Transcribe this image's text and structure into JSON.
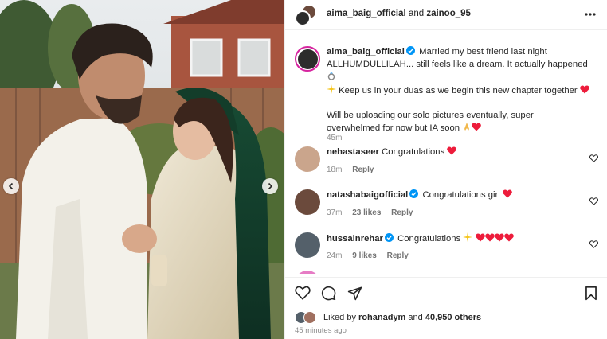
{
  "post": {
    "author": "aima_baig_official",
    "collaborator_joiner": "and",
    "collaborator": "zainoo_95"
  },
  "caption": {
    "username": "aima_baig_official",
    "text_1": "Married my best friend last night ALLHUMDULLILAH... still feels like a dream. It actually happened",
    "text_2": "Keep us in your duas as we begin this new chapter together",
    "text_3": "Will be uploading our solo pictures eventually, super overwhelmed for now but IA soon",
    "time": "45m"
  },
  "comments": [
    {
      "username": "nehastaseer",
      "text": "Congratulations",
      "time": "18m",
      "likes": "",
      "reply": "Reply",
      "verified": false,
      "avatar_color": "#caa58c"
    },
    {
      "username": "natashabaigofficial",
      "text": "Congratulations girl",
      "time": "37m",
      "likes": "23 likes",
      "reply": "Reply",
      "verified": true,
      "avatar_color": "#6b4a3c"
    },
    {
      "username": "hussainrehar",
      "text": "Congratulations",
      "time": "24m",
      "likes": "9 likes",
      "reply": "Reply",
      "verified": true,
      "avatar_color": "#54606a"
    }
  ],
  "likes": {
    "prefix": "Liked by",
    "user": "rohanadym",
    "joiner": "and",
    "others": "40,950 others"
  },
  "posted": "45 minutes ago",
  "colors": {
    "verified_blue": "#0095f6",
    "heart_red": "#ed1c3b",
    "story_ring": "#d6249f",
    "muted_text": "#8e8e8e"
  },
  "icons": [
    "more-icon",
    "heart-icon",
    "comment-icon",
    "share-icon",
    "bookmark-icon",
    "verified-icon",
    "chevron-left-icon",
    "chevron-right-icon"
  ]
}
